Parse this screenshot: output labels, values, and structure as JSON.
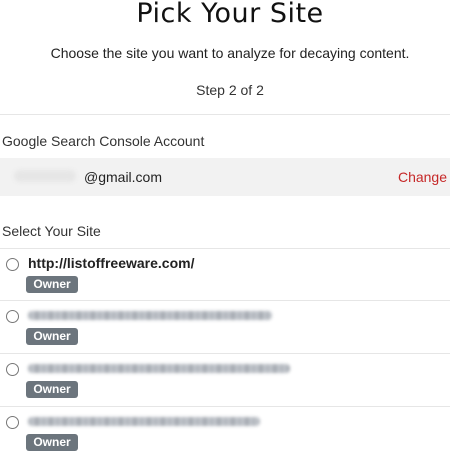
{
  "header": {
    "title": "Pick Your Site",
    "subtitle": "Choose the site you want to analyze for decaying content.",
    "step": "Step 2 of 2"
  },
  "account": {
    "section_label": "Google Search Console Account",
    "email": "@gmail.com",
    "change_label": "Change"
  },
  "sites": {
    "section_label": "Select Your Site",
    "items": [
      {
        "url": "http://listoffreeware.com/",
        "badge": "Owner"
      },
      {
        "url": "",
        "badge": "Owner"
      },
      {
        "url": "",
        "badge": "Owner"
      },
      {
        "url": "",
        "badge": "Owner"
      }
    ]
  },
  "colors": {
    "change_link": "#c62828",
    "badge_bg": "#6c757d",
    "account_bg": "#f2f2f2"
  }
}
